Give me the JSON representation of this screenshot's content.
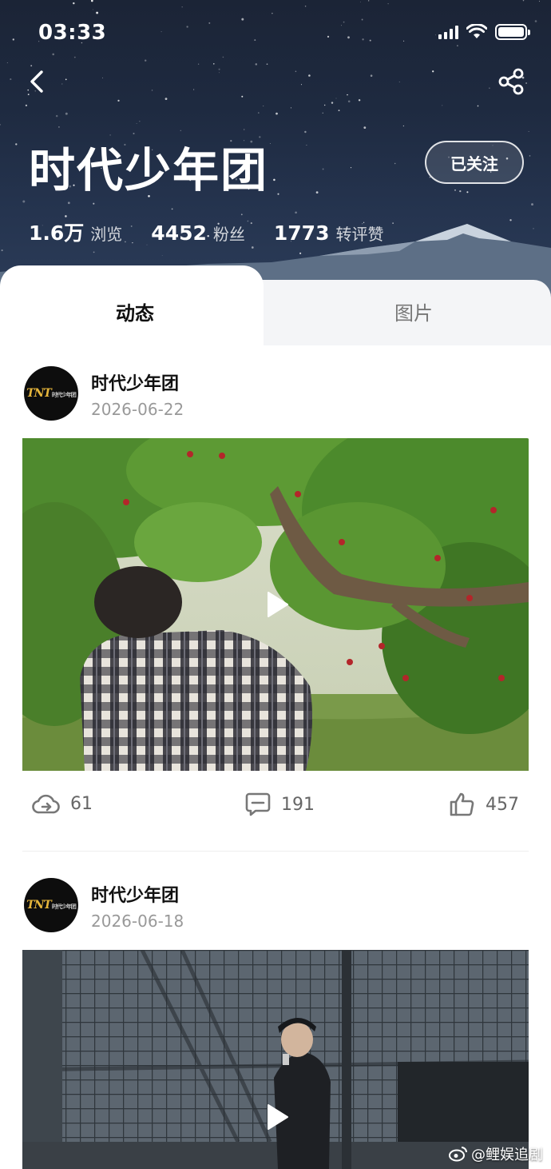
{
  "status_bar": {
    "time": "03:33"
  },
  "header": {
    "title": "时代少年团",
    "follow_label": "已关注",
    "stats": [
      {
        "value": "1.6万",
        "label": "浏览"
      },
      {
        "value": "4452",
        "label": "粉丝"
      },
      {
        "value": "1773",
        "label": "转评赞"
      }
    ]
  },
  "tabs": [
    {
      "label": "动态",
      "active": true
    },
    {
      "label": "图片",
      "active": false
    }
  ],
  "posts": [
    {
      "author": "时代少年团",
      "date": "2026-06-22",
      "media_icon": "play-icon",
      "repost_count": "61",
      "comment_count": "191",
      "like_count": "457"
    },
    {
      "author": "时代少年团",
      "date": "2026-06-18",
      "media_icon": "play-icon"
    }
  ],
  "avatar_logo": {
    "mark": "TNT",
    "sub": "时代少年团"
  },
  "watermark": "@鲤娱追剧",
  "colors": {
    "header_bg": "#1e2a40",
    "accent_gold": "#e5b53b",
    "muted": "#999999"
  }
}
